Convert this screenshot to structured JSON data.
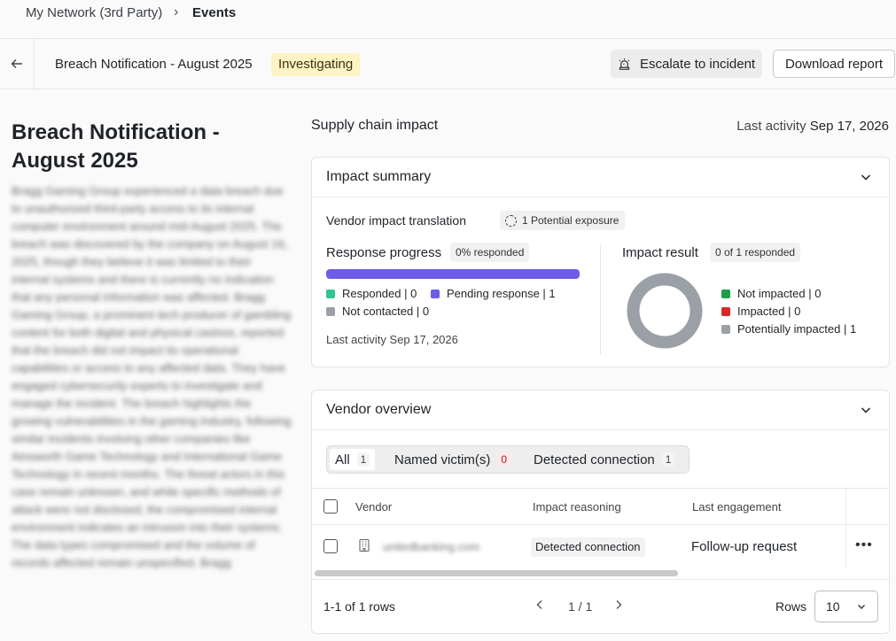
{
  "breadcrumb": {
    "parent": "My Network (3rd Party)",
    "current": "Events"
  },
  "header": {
    "event_title": "Breach Notification - August 2025",
    "status": "Investigating",
    "escalate_label": "Escalate to incident",
    "download_label": "Download report"
  },
  "page": {
    "title": "Breach Notification - August 2025",
    "description": "Bragg Gaming Group experienced a data breach due to unauthorized third-party access to its internal computer environment around mid-August 2025. The breach was discovered by the company on August 16, 2025, though they believe it was limited to their internal systems and there is currently no indication that any personal information was affected. Bragg Gaming Group, a prominent tech producer of gambling content for both digital and physical casinos, reported that the breach did not impact its operational capabilities or access to any affected data. They have engaged cybersecurity experts to investigate and manage the incident. The breach highlights the growing vulnerabilities in the gaming industry, following similar incidents involving other companies like Ainsworth Game Technology and International Game Technology in recent months. The threat actors in this case remain unknown, and while specific methods of attack were not disclosed, the compromised internal environment indicates an intrusion into their systems. The data types compromised and the volume of records affected remain unspecified. Bragg"
  },
  "supply_chain": {
    "title": "Supply chain impact",
    "last_activity_label": "Last activity",
    "last_activity_date": "Sep 17, 2026"
  },
  "impact_summary": {
    "title": "Impact summary",
    "vendor_impact_label": "Vendor impact translation",
    "vendor_impact_pill": "1 Potential exposure",
    "response_progress": {
      "label": "Response progress",
      "pill": "0% responded",
      "pending_fraction": 1.0,
      "legend": [
        {
          "label": "Responded | 0",
          "color": "#34c38f"
        },
        {
          "label": "Pending response | 1",
          "color": "#6c5ce7"
        },
        {
          "label": "Not contacted | 0",
          "color": "#9aa0a6"
        }
      ],
      "last_activity": "Last activity Sep 17, 2026"
    },
    "impact_result": {
      "label": "Impact result",
      "pill": "0 of 1 responded",
      "legend": [
        {
          "label": "Not impacted | 0",
          "color": "#1e9e4a",
          "value": 0
        },
        {
          "label": "Impacted | 0",
          "color": "#d62828",
          "value": 0
        },
        {
          "label": "Potentially impacted | 1",
          "color": "#9aa0a6",
          "value": 1
        }
      ]
    }
  },
  "vendor_overview": {
    "title": "Vendor overview",
    "tabs": [
      {
        "label": "All",
        "count": "1"
      },
      {
        "label": "Named victim(s)",
        "count": "0"
      },
      {
        "label": "Detected connection",
        "count": "1"
      }
    ],
    "columns": {
      "vendor": "Vendor",
      "reasoning": "Impact reasoning",
      "engagement": "Last engagement"
    },
    "rows": [
      {
        "vendor": "unitedbanking.com",
        "reasoning": "Detected connection",
        "engagement": "Follow-up request"
      }
    ],
    "footer": {
      "count_text": "1-1 of 1 rows",
      "page_text": "1 / 1",
      "rows_label": "Rows",
      "rows_value": "10"
    }
  }
}
